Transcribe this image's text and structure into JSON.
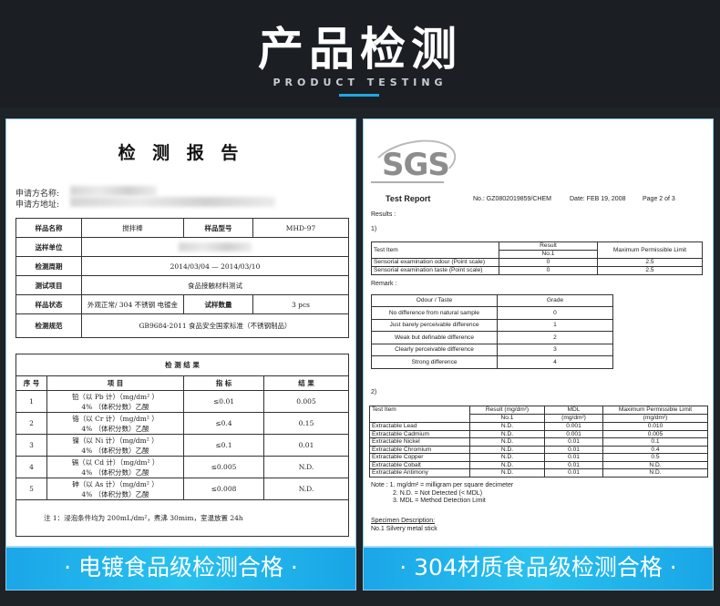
{
  "header": {
    "title": "产品检测",
    "subtitle": "PRODUCT TESTING"
  },
  "left_report": {
    "title": "检 测 报 告",
    "applicant_name_label": "申请方名称:",
    "applicant_address_label": "申请方地址:",
    "info": {
      "sample_name_label": "样品名称",
      "sample_name": "搅拌棒",
      "model_label": "样品型号",
      "model": "MHD-97",
      "sender_label": "送样单位",
      "period_label": "检测周期",
      "period": "2014/03/04 — 2014/03/10",
      "item_label": "测试项目",
      "item": "食品接触材料测试",
      "state_label": "样品状态",
      "state": "外观正常/ 304 不锈钢 电镀金",
      "quantity_label": "试样数量",
      "quantity": "3 pcs",
      "standard_label": "检测规范",
      "standard": "GB9684-2011 食品安全国家标准（不锈钢制品）"
    },
    "results": {
      "heading": "检 测 结 果",
      "columns": [
        "序 号",
        "项 目",
        "指 标",
        "结 果"
      ],
      "rows": [
        {
          "no": "1",
          "item1": "铅（以 Pb 计）（mg/dm² ）",
          "item2": "4% （体积分数）乙酸",
          "limit": "≤0.01",
          "result": "0.005"
        },
        {
          "no": "2",
          "item1": "铬（以 Cr 计）（mg/dm² ）",
          "item2": "4% （体积分数）乙酸",
          "limit": "≤0.4",
          "result": "0.15"
        },
        {
          "no": "3",
          "item1": "镍（以 Ni 计）（mg/dm² ）",
          "item2": "4% （体积分数）乙酸",
          "limit": "≤0.1",
          "result": "0.01"
        },
        {
          "no": "4",
          "item1": "镉（以 Cd 计）（mg/dm² ）",
          "item2": "4% （体积分数）乙酸",
          "limit": "≤0.005",
          "result": "N.D."
        },
        {
          "no": "5",
          "item1": "砷（以 As 计）（mg/dm² ）",
          "item2": "4% （体积分数）乙酸",
          "limit": "≤0.008",
          "result": "N.D."
        }
      ],
      "note": "注 1：浸泡条件均为 200mL/dm²，煮沸 30mim，室温放置 24h"
    }
  },
  "right_report": {
    "logo": "SGS",
    "report_title": "Test Report",
    "report_no": "No.: GZ0802019859/CHEM",
    "date": "Date: FEB 19, 2008",
    "page": "Page 2 of 3",
    "results_label": "Results :",
    "section1": "1)",
    "t1": {
      "h_item": "Test Item",
      "h_result": "Result",
      "h_no": "No.1",
      "h_limit": "Maximum Permissible Limit",
      "rows": [
        {
          "item": "Sensorial examination odour (Point scale)",
          "result": "0",
          "limit": "2.5"
        },
        {
          "item": "Sensorial examination taste (Point scale)",
          "result": "0",
          "limit": "2.5"
        }
      ]
    },
    "remark_label": "Remark :",
    "t2": {
      "h_odour": "Odour / Taste",
      "h_grade": "Grade",
      "rows": [
        {
          "desc": "No difference from natural sample",
          "grade": "0"
        },
        {
          "desc": "Just barely perceivable difference",
          "grade": "1"
        },
        {
          "desc": "Weak but definable difference",
          "grade": "2"
        },
        {
          "desc": "Clearly perceivable difference",
          "grade": "3"
        },
        {
          "desc": "Strong difference",
          "grade": "4"
        }
      ]
    },
    "section2": "2)",
    "t3": {
      "h_item": "Test Item",
      "h_result": "Result (mg/dm²)",
      "h_no": "No.1",
      "h_mdl": "MDL",
      "h_mdl_unit": "(mg/dm²)",
      "h_limit": "Maximum Permissible Limit",
      "h_limit_unit": "(mg/dm²)",
      "rows": [
        {
          "item": "Extractable Lead",
          "result": "N.D.",
          "mdl": "0.001",
          "limit": "0.010"
        },
        {
          "item": "Extractable Cadmium",
          "result": "N.D.",
          "mdl": "0.001",
          "limit": "0.005"
        },
        {
          "item": "Extractable Nickel",
          "result": "N.D.",
          "mdl": "0.01",
          "limit": "0.1"
        },
        {
          "item": "Extractable Chromium",
          "result": "N.D.",
          "mdl": "0.01",
          "limit": "0.4"
        },
        {
          "item": "Extractable Copper",
          "result": "N.D.",
          "mdl": "0.01",
          "limit": "0.5"
        },
        {
          "item": "Extractable Cobalt",
          "result": "N.D.",
          "mdl": "0.01",
          "limit": "N.D."
        },
        {
          "item": "Extractable Antimony",
          "result": "N.D.",
          "mdl": "0.01",
          "limit": "N.D."
        }
      ]
    },
    "note1": "Note  :  1. mg/dm² = milligram per square decimeter",
    "note2": "2. N.D. = Not Detected (< MDL)",
    "note3": "3. MDL = Method Detection Limit",
    "specimen_label": "Specimen Description:",
    "specimen": "No.1  Silvery metal stick"
  },
  "banners": {
    "left": "· 电镀食品级检测合格 ·",
    "right": "· 304材质食品级检测合格 ·"
  }
}
